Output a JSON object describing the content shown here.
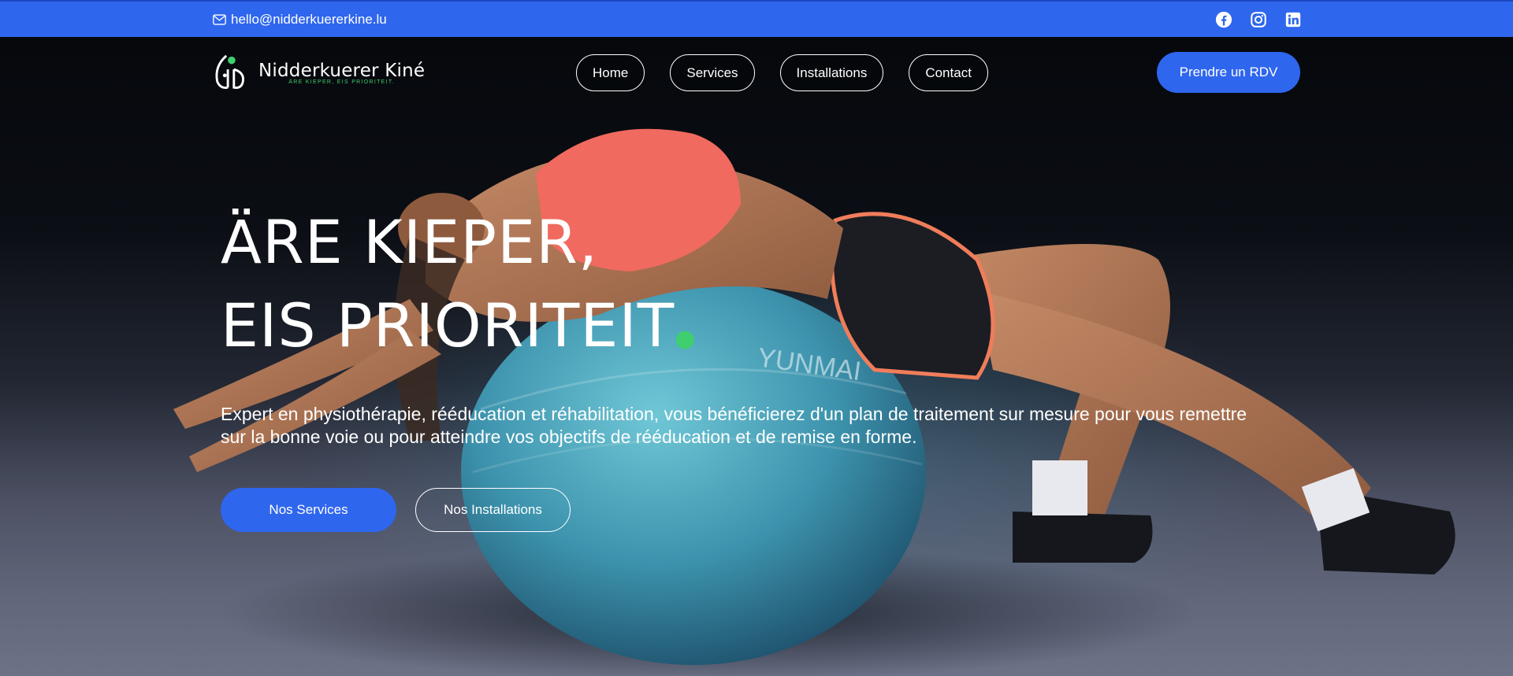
{
  "topbar": {
    "email": "hello@nidderkuererkine.lu",
    "socials": [
      "facebook-icon",
      "instagram-icon",
      "linkedin-icon"
    ]
  },
  "header": {
    "logo_name": "Nidderkuerer Kiné",
    "logo_tagline": "ÄRE KIEPER, EIS PRIORITEIT.",
    "nav": [
      {
        "label": "Home"
      },
      {
        "label": "Services"
      },
      {
        "label": "Installations"
      },
      {
        "label": "Contact"
      }
    ],
    "cta_label": "Prendre un RDV"
  },
  "hero": {
    "headline_line1": "ÄRE KIEPER,",
    "headline_line2": "EIS PRIORITEIT",
    "description": "Expert en physiothérapie, rééducation et réhabilitation, vous bénéficierez d'un plan de traitement sur mesure pour vous remettre sur la bonne voie ou pour atteindre vos objectifs de rééducation et de remise en forme.",
    "primary_button": "Nos Services",
    "secondary_button": "Nos Installations",
    "ball_brand": "YUNMAI"
  },
  "colors": {
    "accent": "#2f66ee",
    "brand_green": "#3fcf6e",
    "text": "#ffffff"
  }
}
